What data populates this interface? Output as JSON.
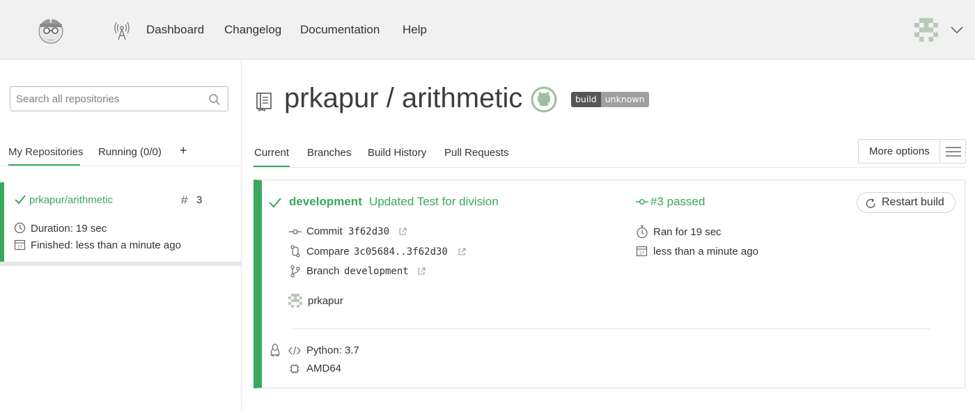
{
  "nav": {
    "links": [
      "Dashboard",
      "Changelog",
      "Documentation",
      "Help"
    ]
  },
  "sidebar": {
    "search_placeholder": "Search all repositories",
    "tabs": [
      "My Repositories",
      "Running (0/0)"
    ],
    "add_label": "+",
    "repo": {
      "name": "prkapur/arithmetic",
      "hash": "#",
      "build_number": "3",
      "duration": "Duration: 19 sec",
      "finished": "Finished: less than a minute ago"
    }
  },
  "main": {
    "title": "prkapur / arithmetic",
    "badge": {
      "left": "build",
      "right": "unknown"
    },
    "tabs": [
      "Current",
      "Branches",
      "Build History",
      "Pull Requests"
    ],
    "more_options": "More options",
    "build": {
      "branch": "development",
      "message": "Updated Test for division",
      "status": "#3 passed",
      "restart_label": "Restart build",
      "commit_label": "Commit",
      "commit_hash": "3f62d30",
      "compare_label": "Compare",
      "compare_range": "3c05684..3f62d30",
      "branch_label": "Branch",
      "branch_name": "development",
      "author": "prkapur",
      "ran_for": "Ran for 19 sec",
      "finished": "less than a minute ago",
      "language": "Python: 3.7",
      "arch": "AMD64",
      "calendar_day": "27"
    }
  },
  "colors": {
    "accent_green": "#39a85b",
    "topbar_bg": "#f1f1f1",
    "badge_dark": "#555555",
    "badge_grey": "#9f9f9f"
  },
  "icons": [
    "travis-logo-icon",
    "tower-icon",
    "identicon-avatar",
    "chevron-down-icon",
    "search-icon",
    "check-icon",
    "clock-icon",
    "calendar-icon",
    "book-icon",
    "github-icon",
    "hamburger-icon",
    "restart-icon",
    "commit-icon",
    "compare-icon",
    "branch-icon",
    "external-link-icon",
    "stopwatch-icon",
    "linux-icon",
    "code-icon",
    "cpu-icon"
  ]
}
